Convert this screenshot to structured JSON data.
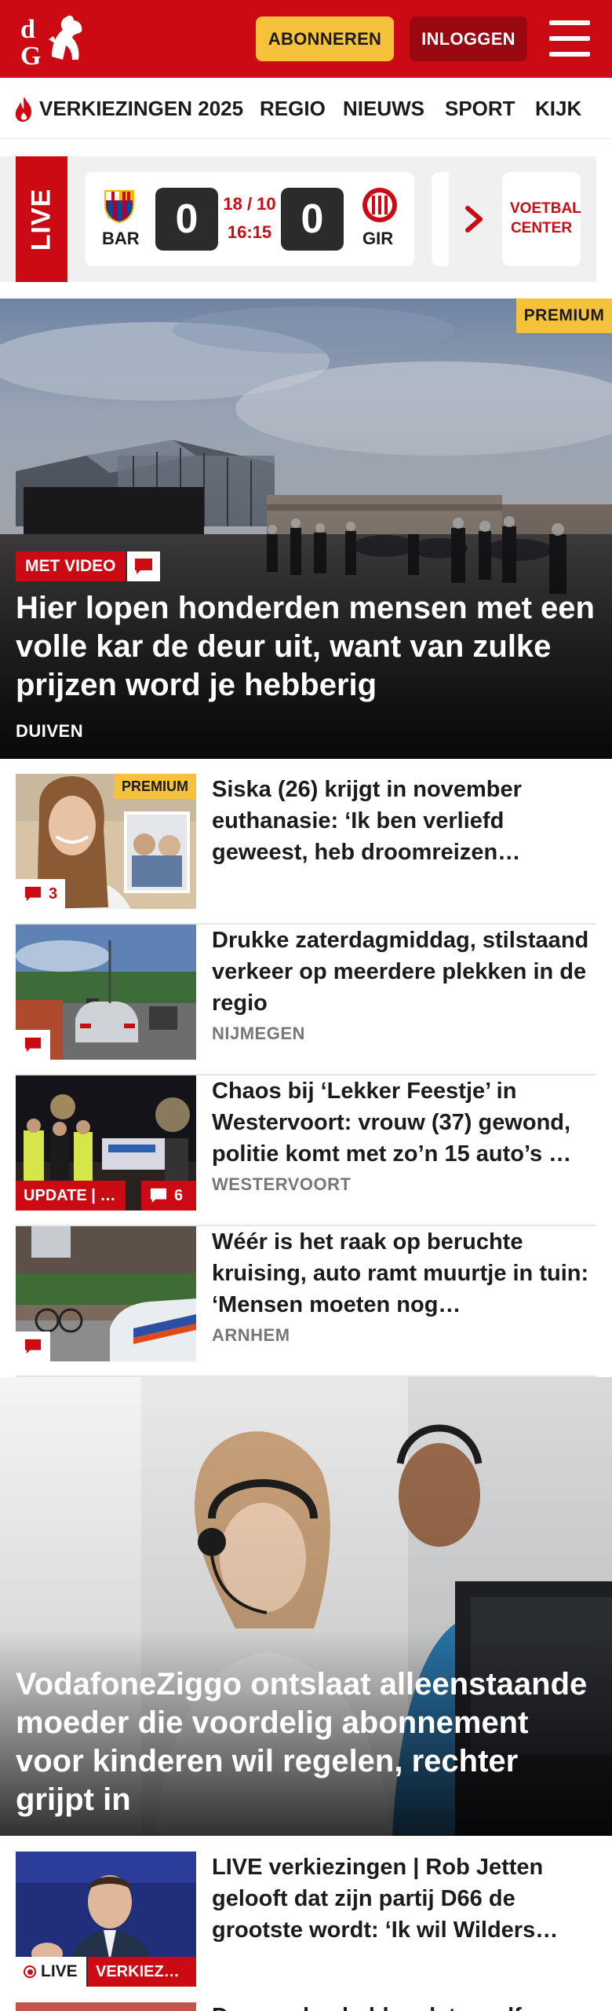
{
  "header": {
    "logo_text": "dG",
    "subscribe_label": "ABONNEREN",
    "login_label": "INLOGGEN",
    "brand_color": "#cc0a14"
  },
  "nav": {
    "items": [
      "VERKIEZINGEN 2025",
      "REGIO",
      "NIEUWS",
      "SPORT",
      "KIJK"
    ]
  },
  "live_scores": {
    "label": "LIVE",
    "match": {
      "home": "BAR",
      "away": "GIR",
      "home_score": "0",
      "away_score": "0",
      "date": "18 / 10",
      "time": "16:15"
    },
    "voetbal_center_label": "VOETBAL CENTER"
  },
  "hero": {
    "premium": "PREMIUM",
    "tag": "MET VIDEO",
    "title": "Hier lopen honderden mensen met een volle kar de deur uit, want van zulke prijzen word je hebberig",
    "place": "DUIVEN"
  },
  "articles": [
    {
      "title": "Siska (26) krijgt in november euthanasie: ‘Ik ben verliefd geweest, heb droomreizen…",
      "place": "",
      "comments": "3",
      "premium": "PREMIUM",
      "tag": ""
    },
    {
      "title": "Drukke zaterdagmiddag, stilstaand verkeer op meerdere plekken in de regio",
      "place": "NIJMEGEN",
      "comments": "",
      "premium": "",
      "tag": ""
    },
    {
      "title": "Chaos bij ‘Lekker Feestje’ in Westervoort: vrouw (37) gewond, politie komt met zo’n 15 auto’s …",
      "place": "WESTERVOORT",
      "comments": "6",
      "premium": "",
      "tag": "UPDATE | …"
    },
    {
      "title": "Wéér is het raak op beruchte kruising, auto ramt muurtje in tuin: ‘Mensen moeten nog…",
      "place": "ARNHEM",
      "comments": "",
      "premium": "",
      "tag": ""
    }
  ],
  "hero2": {
    "title": "VodafoneZiggo ontslaat alleenstaan­de moeder die voordelig abonnement voor kinderen wil regelen, rechter grijpt in"
  },
  "article_live": {
    "title": "LIVE verkiezingen | Rob Jetten gelooft dat zijn partij D66 de grootste wordt: ‘Ik wil Wilders…",
    "live_label": "LIVE",
    "tag": "VERKIEZ…"
  },
  "article_partial": {
    "title": "De paarden hebben later zelf..."
  }
}
